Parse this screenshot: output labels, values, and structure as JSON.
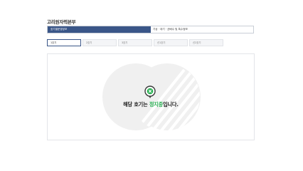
{
  "page": {
    "title": "고리원자력본부"
  },
  "header": {
    "left_label": "호기별운영정보",
    "right_label": "기상 · 대기 · 균배수 및 특수정보"
  },
  "tabs": [
    {
      "label": "1호기",
      "active": true
    },
    {
      "label": "2호기",
      "active": false
    },
    {
      "label": "3호기",
      "active": false
    },
    {
      "label": "신1호기",
      "active": false
    },
    {
      "label": "신2호기",
      "active": false
    }
  ],
  "status": {
    "message_before": "해당 호기는 ",
    "message_highlight": "정지중",
    "message_after": "입니다.",
    "highlight_color": "#2bb154",
    "icon": "stop-circle-icon"
  },
  "colors": {
    "header_accent": "#3a5688",
    "status_green": "#2bb154"
  }
}
